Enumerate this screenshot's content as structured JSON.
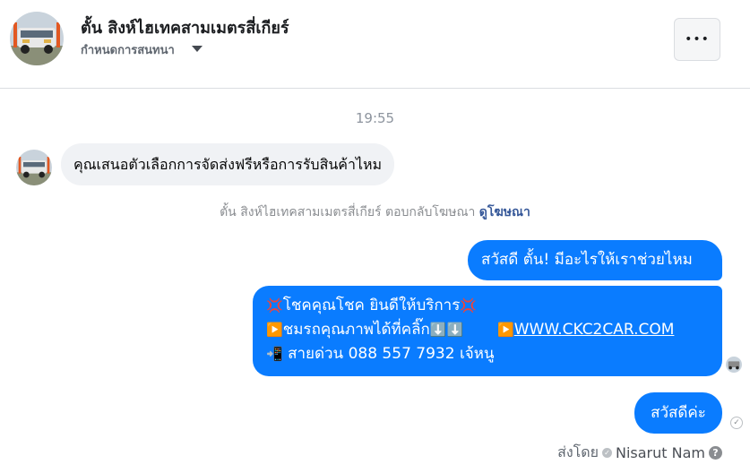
{
  "header": {
    "title": "ตั้น สิงห์ไฮเทคสามเมตรสี่เกียร์",
    "subtitle": "กำหนดการสนทนา",
    "more_label": "•••"
  },
  "chat": {
    "timestamp": "19:55",
    "incoming_message": "คุณเสนอตัวเลือกการจัดส่งฟรีหรือการรับสินค้าไหม",
    "reply_note": "ตั้น สิงห์ไฮเทคสามเมตรสี่เกียร์ ตอบกลับโฆษณา",
    "reply_link": "ดูโฆษณา",
    "outgoing_1": "สวัสดี ตั้น! มีอะไรให้เราช่วยไหม",
    "outgoing_2": {
      "line1_icon": "💢",
      "line1_text": "โชคคุณโชค ยินดีให้บริการ",
      "line1_icon_end": "💢",
      "line2_icon": "▶️",
      "line2_text": "ชมรถคุณภาพได้ที่คลิ๊ก",
      "line2_arrows": "⬇️⬇️",
      "line2_icon2": "▶️",
      "line2_link": "WWW.CKC2CAR.COM",
      "line3_icon": "📲",
      "line3_text": " สายด่วน 088 557 7932 เจ้หนู"
    },
    "outgoing_3": "สวัสดีค่ะ",
    "sent_by_label": "ส่งโดย",
    "sent_by_name": "Nisarut Nam",
    "help_glyph": "?",
    "check_glyph": "✓"
  },
  "colors": {
    "accent": "#0a7cff",
    "incoming_bg": "#f0f2f5"
  },
  "icons": [
    "truck-avatar",
    "chevron-down-icon",
    "more-icon",
    "check-icon",
    "help-icon",
    "sender-icon"
  ]
}
